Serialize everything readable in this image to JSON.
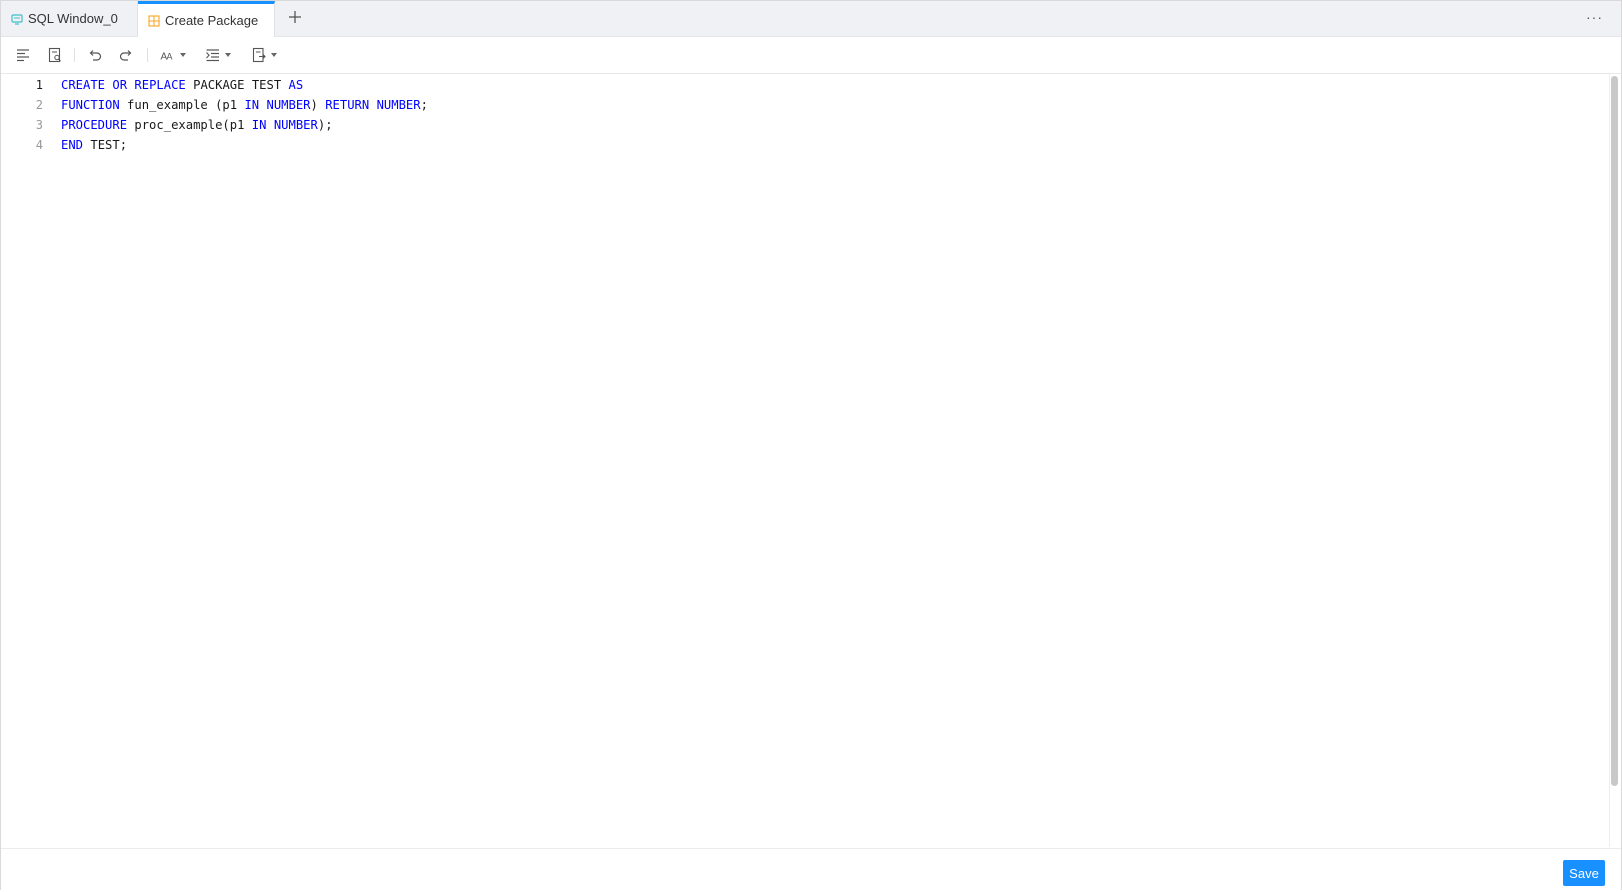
{
  "tabs": [
    {
      "label": "SQL Window_0",
      "icon": "sql-window-icon"
    },
    {
      "label": "Create Package",
      "icon": "package-icon",
      "active": true
    }
  ],
  "tabbar": {
    "add_icon": "plus-icon",
    "more_label": "···"
  },
  "toolbar": {
    "items": [
      "format-icon",
      "find-icon",
      "undo-icon",
      "redo-icon",
      "font-case-icon",
      "indent-icon",
      "export-icon"
    ]
  },
  "editor": {
    "lines": [
      {
        "number": "1",
        "tokens": [
          [
            "kw",
            "CREATE"
          ],
          [
            "t",
            " "
          ],
          [
            "kw",
            "OR"
          ],
          [
            "t",
            " "
          ],
          [
            "kw",
            "REPLACE"
          ],
          [
            "t",
            " PACKAGE TEST "
          ],
          [
            "kw",
            "AS"
          ]
        ]
      },
      {
        "number": "2",
        "tokens": [
          [
            "kw",
            "FUNCTION"
          ],
          [
            "t",
            " fun_example (p1 "
          ],
          [
            "kw",
            "IN"
          ],
          [
            "t",
            " "
          ],
          [
            "kw",
            "NUMBER"
          ],
          [
            "t",
            ") "
          ],
          [
            "kw",
            "RETURN"
          ],
          [
            "t",
            " "
          ],
          [
            "kw",
            "NUMBER"
          ],
          [
            "t",
            ";"
          ]
        ]
      },
      {
        "number": "3",
        "tokens": [
          [
            "kw",
            "PROCEDURE"
          ],
          [
            "t",
            " proc_example(p1 "
          ],
          [
            "kw",
            "IN"
          ],
          [
            "t",
            " "
          ],
          [
            "kw",
            "NUMBER"
          ],
          [
            "t",
            ");"
          ]
        ]
      },
      {
        "number": "4",
        "tokens": [
          [
            "kw",
            "END"
          ],
          [
            "t",
            " TEST;"
          ]
        ]
      }
    ]
  },
  "footer": {
    "save_label": "Save"
  },
  "colors": {
    "accent": "#1890ff",
    "keyword": "#0000ff"
  }
}
